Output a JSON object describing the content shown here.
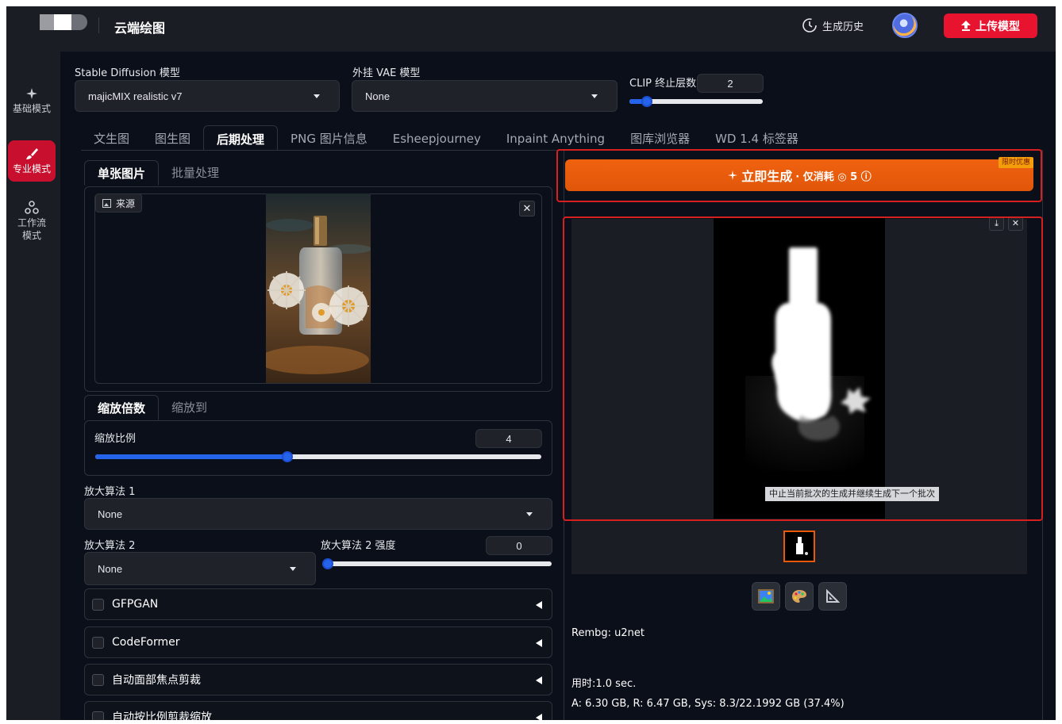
{
  "header": {
    "app_title": "云端绘图",
    "history_label": "生成历史",
    "upload_label": "上传模型"
  },
  "sidebar": {
    "items": [
      {
        "label": "基础模式",
        "icon": "sparkle-icon"
      },
      {
        "label": "专业模式",
        "icon": "brush-icon"
      },
      {
        "label": "工作流模式",
        "icon": "workflow-icon"
      }
    ]
  },
  "settings": {
    "sd_model_label": "Stable Diffusion 模型",
    "sd_model_value": "majicMIX realistic v7",
    "vae_label": "外挂 VAE 模型",
    "vae_value": "None",
    "clip_label": "CLIP 终止层数",
    "clip_value": "2",
    "clip_fraction": 0.13
  },
  "tabs": [
    "文生图",
    "图生图",
    "后期处理",
    "PNG 图片信息",
    "Esheepjourney",
    "Inpaint Anything",
    "图库浏览器",
    "WD 1.4 标签器"
  ],
  "active_tab": 2,
  "left": {
    "subtabs": [
      "单张图片",
      "批量处理"
    ],
    "source_label": "来源",
    "scale_tabs": [
      "缩放倍数",
      "缩放到"
    ],
    "scale_label": "缩放比例",
    "scale_value": "4",
    "scale_fraction": 0.43,
    "upscaler1_label": "放大算法 1",
    "upscaler1_value": "None",
    "upscaler2_label": "放大算法 2",
    "upscaler2_value": "None",
    "upscaler2_strength_label": "放大算法 2 强度",
    "upscaler2_strength_value": "0",
    "accordions": [
      "GFPGAN",
      "CodeFormer",
      "自动面部焦点剪裁",
      "自动按比例剪裁缩放"
    ]
  },
  "right": {
    "generate_label": "立即生成",
    "cost_text": "· 仅消耗 ◎ 5 ⓘ",
    "promo_badge": "限时优惠",
    "tooltip": "中止当前批次的生成并继续生成下一个批次",
    "rembg_info": "Rembg: u2net",
    "time_info": "用时:1.0 sec.",
    "memory_info": "A: 6.30 GB, R: 6.47 GB, Sys: 8.3/22.1992 GB (37.4%)"
  },
  "colors": {
    "accent_blue": "#2563eb",
    "generate_orange": "#e8590c",
    "upload_red": "#e8132f",
    "highlight_red": "#d61f1f"
  }
}
